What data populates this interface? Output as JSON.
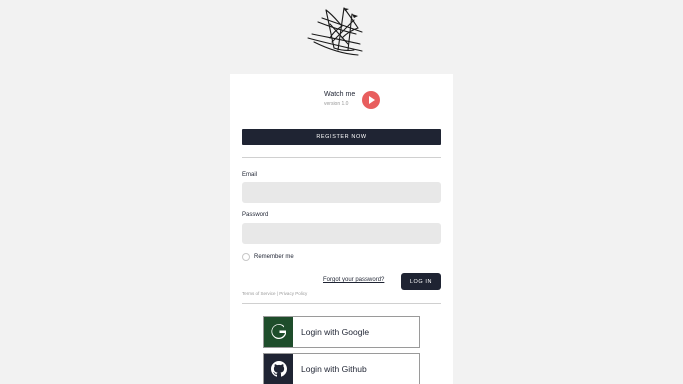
{
  "watch": {
    "title": "Watch me",
    "version": "version 1.0"
  },
  "register_label": "REGISTER NOW",
  "email": {
    "label": "Email",
    "value": "",
    "placeholder": ""
  },
  "password": {
    "label": "Password",
    "value": "",
    "placeholder": ""
  },
  "remember_label": "Remember me",
  "forgot_label": "Forgot your password?",
  "login_label": "LOG IN",
  "legal": {
    "terms": "Terms of Service",
    "separator": " | ",
    "privacy": "Privacy Policy"
  },
  "social": {
    "google_label": "Login with Google",
    "github_label": "Login with Github"
  },
  "colors": {
    "page_bg": "#f2f2f2",
    "card_bg": "#ffffff",
    "dark": "#1f2433",
    "play_accent": "#e85e5e",
    "google_bg": "#1e4d2b"
  },
  "icons": [
    "ship-logo-icon",
    "play-icon",
    "google-g-icon",
    "github-icon"
  ]
}
